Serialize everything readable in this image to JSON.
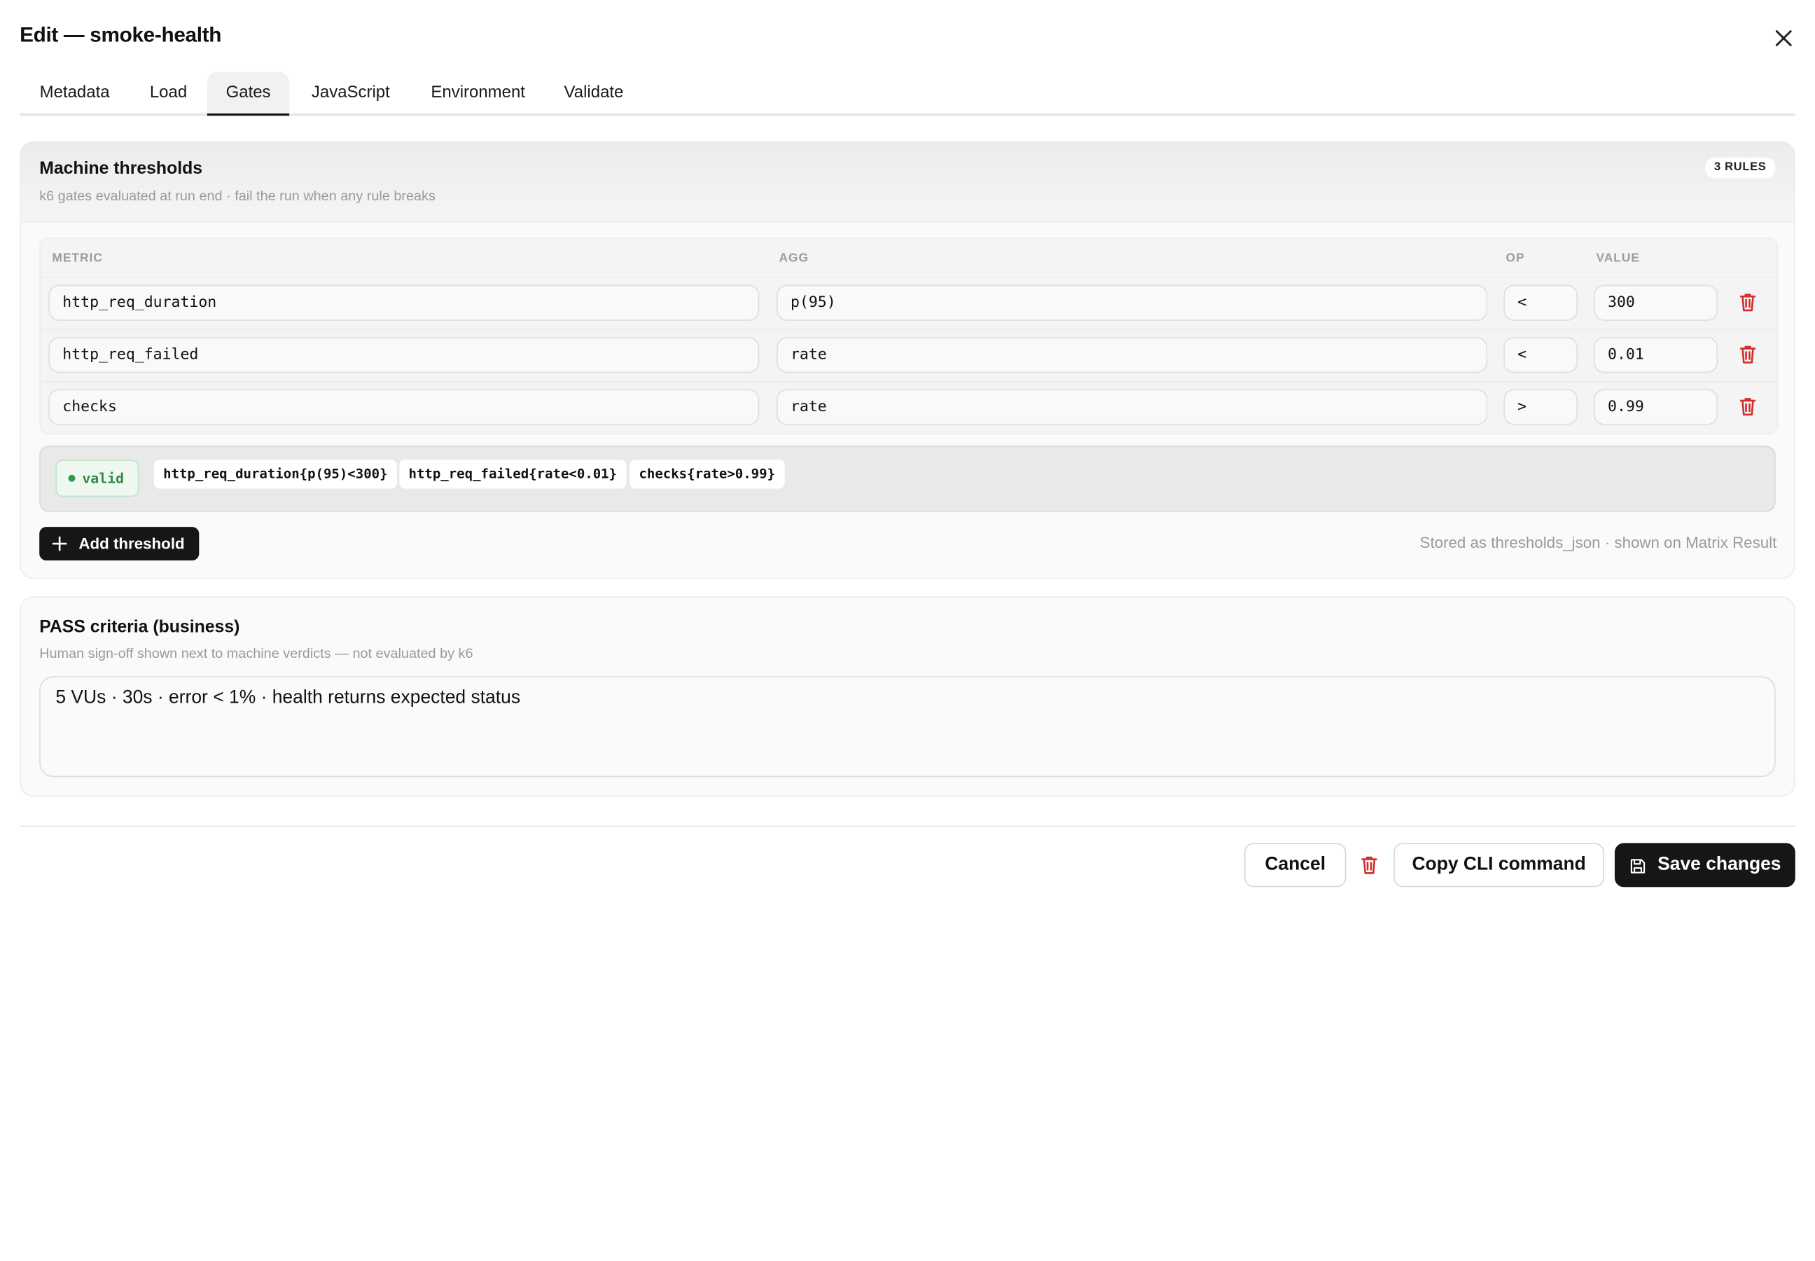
{
  "dialog": {
    "title": "Edit — smoke-health"
  },
  "tabs": [
    {
      "label": "Metadata"
    },
    {
      "label": "Load"
    },
    {
      "label": "Gates"
    },
    {
      "label": "JavaScript"
    },
    {
      "label": "Environment"
    },
    {
      "label": "Validate"
    }
  ],
  "active_tab": "Gates",
  "thresholds": {
    "title": "Machine thresholds",
    "subtitle": "k6 gates evaluated at run end · fail the run when any rule breaks",
    "badge": "3 RULES",
    "columns": {
      "metric": "METRIC",
      "agg": "AGG",
      "op": "OP",
      "value": "VALUE"
    },
    "rows": [
      {
        "metric": "http_req_duration",
        "agg": "p(95)",
        "op": "<",
        "value": "300"
      },
      {
        "metric": "http_req_failed",
        "agg": "rate",
        "op": "<",
        "value": "0.01"
      },
      {
        "metric": "checks",
        "agg": "rate",
        "op": ">",
        "value": "0.99"
      }
    ],
    "validation": {
      "status": "valid",
      "expressions": [
        "http_req_duration{p(95)<300}",
        "http_req_failed{rate<0.01}",
        "checks{rate>0.99}"
      ]
    },
    "add_label": "Add threshold",
    "stored_note": "Stored as thresholds_json · shown on Matrix Result"
  },
  "pass_criteria": {
    "title": "PASS criteria (business)",
    "subtitle": "Human sign-off shown next to machine verdicts — not evaluated by k6",
    "text": "5 VUs · 30s · error < 1% · health returns expected status"
  },
  "footer": {
    "cancel": "Cancel",
    "copy_cli": "Copy CLI command",
    "save": "Save changes"
  },
  "colors": {
    "danger": "#d32f2f",
    "dark": "#161616",
    "valid": "#2f8a45"
  },
  "icons": [
    "close-icon",
    "trash-icon",
    "plus-icon",
    "save-icon"
  ]
}
